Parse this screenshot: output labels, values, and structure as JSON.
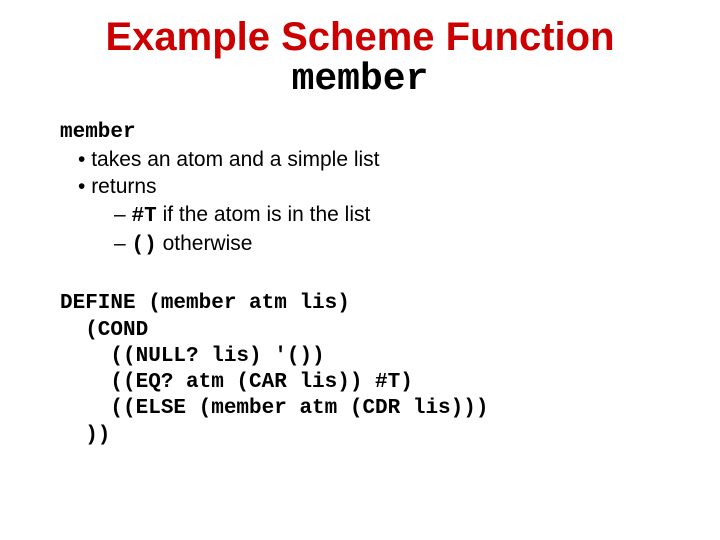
{
  "title": {
    "line1": "Example Scheme Function",
    "line2": "member"
  },
  "desc": {
    "heading": "member",
    "bullet1": "takes an atom and a simple list",
    "bullet2": "returns",
    "sub1_code": "#T",
    "sub1_text": " if the atom is in the list",
    "sub2_code": "()",
    "sub2_text": " otherwise"
  },
  "code": {
    "l1": "DEFINE (member atm lis)",
    "l2": "  (COND",
    "l3": "    ((NULL? lis) '())",
    "l4": "    ((EQ? atm (CAR lis)) #T)",
    "l5": "    ((ELSE (member atm (CDR lis)))",
    "l6": "  ))"
  }
}
